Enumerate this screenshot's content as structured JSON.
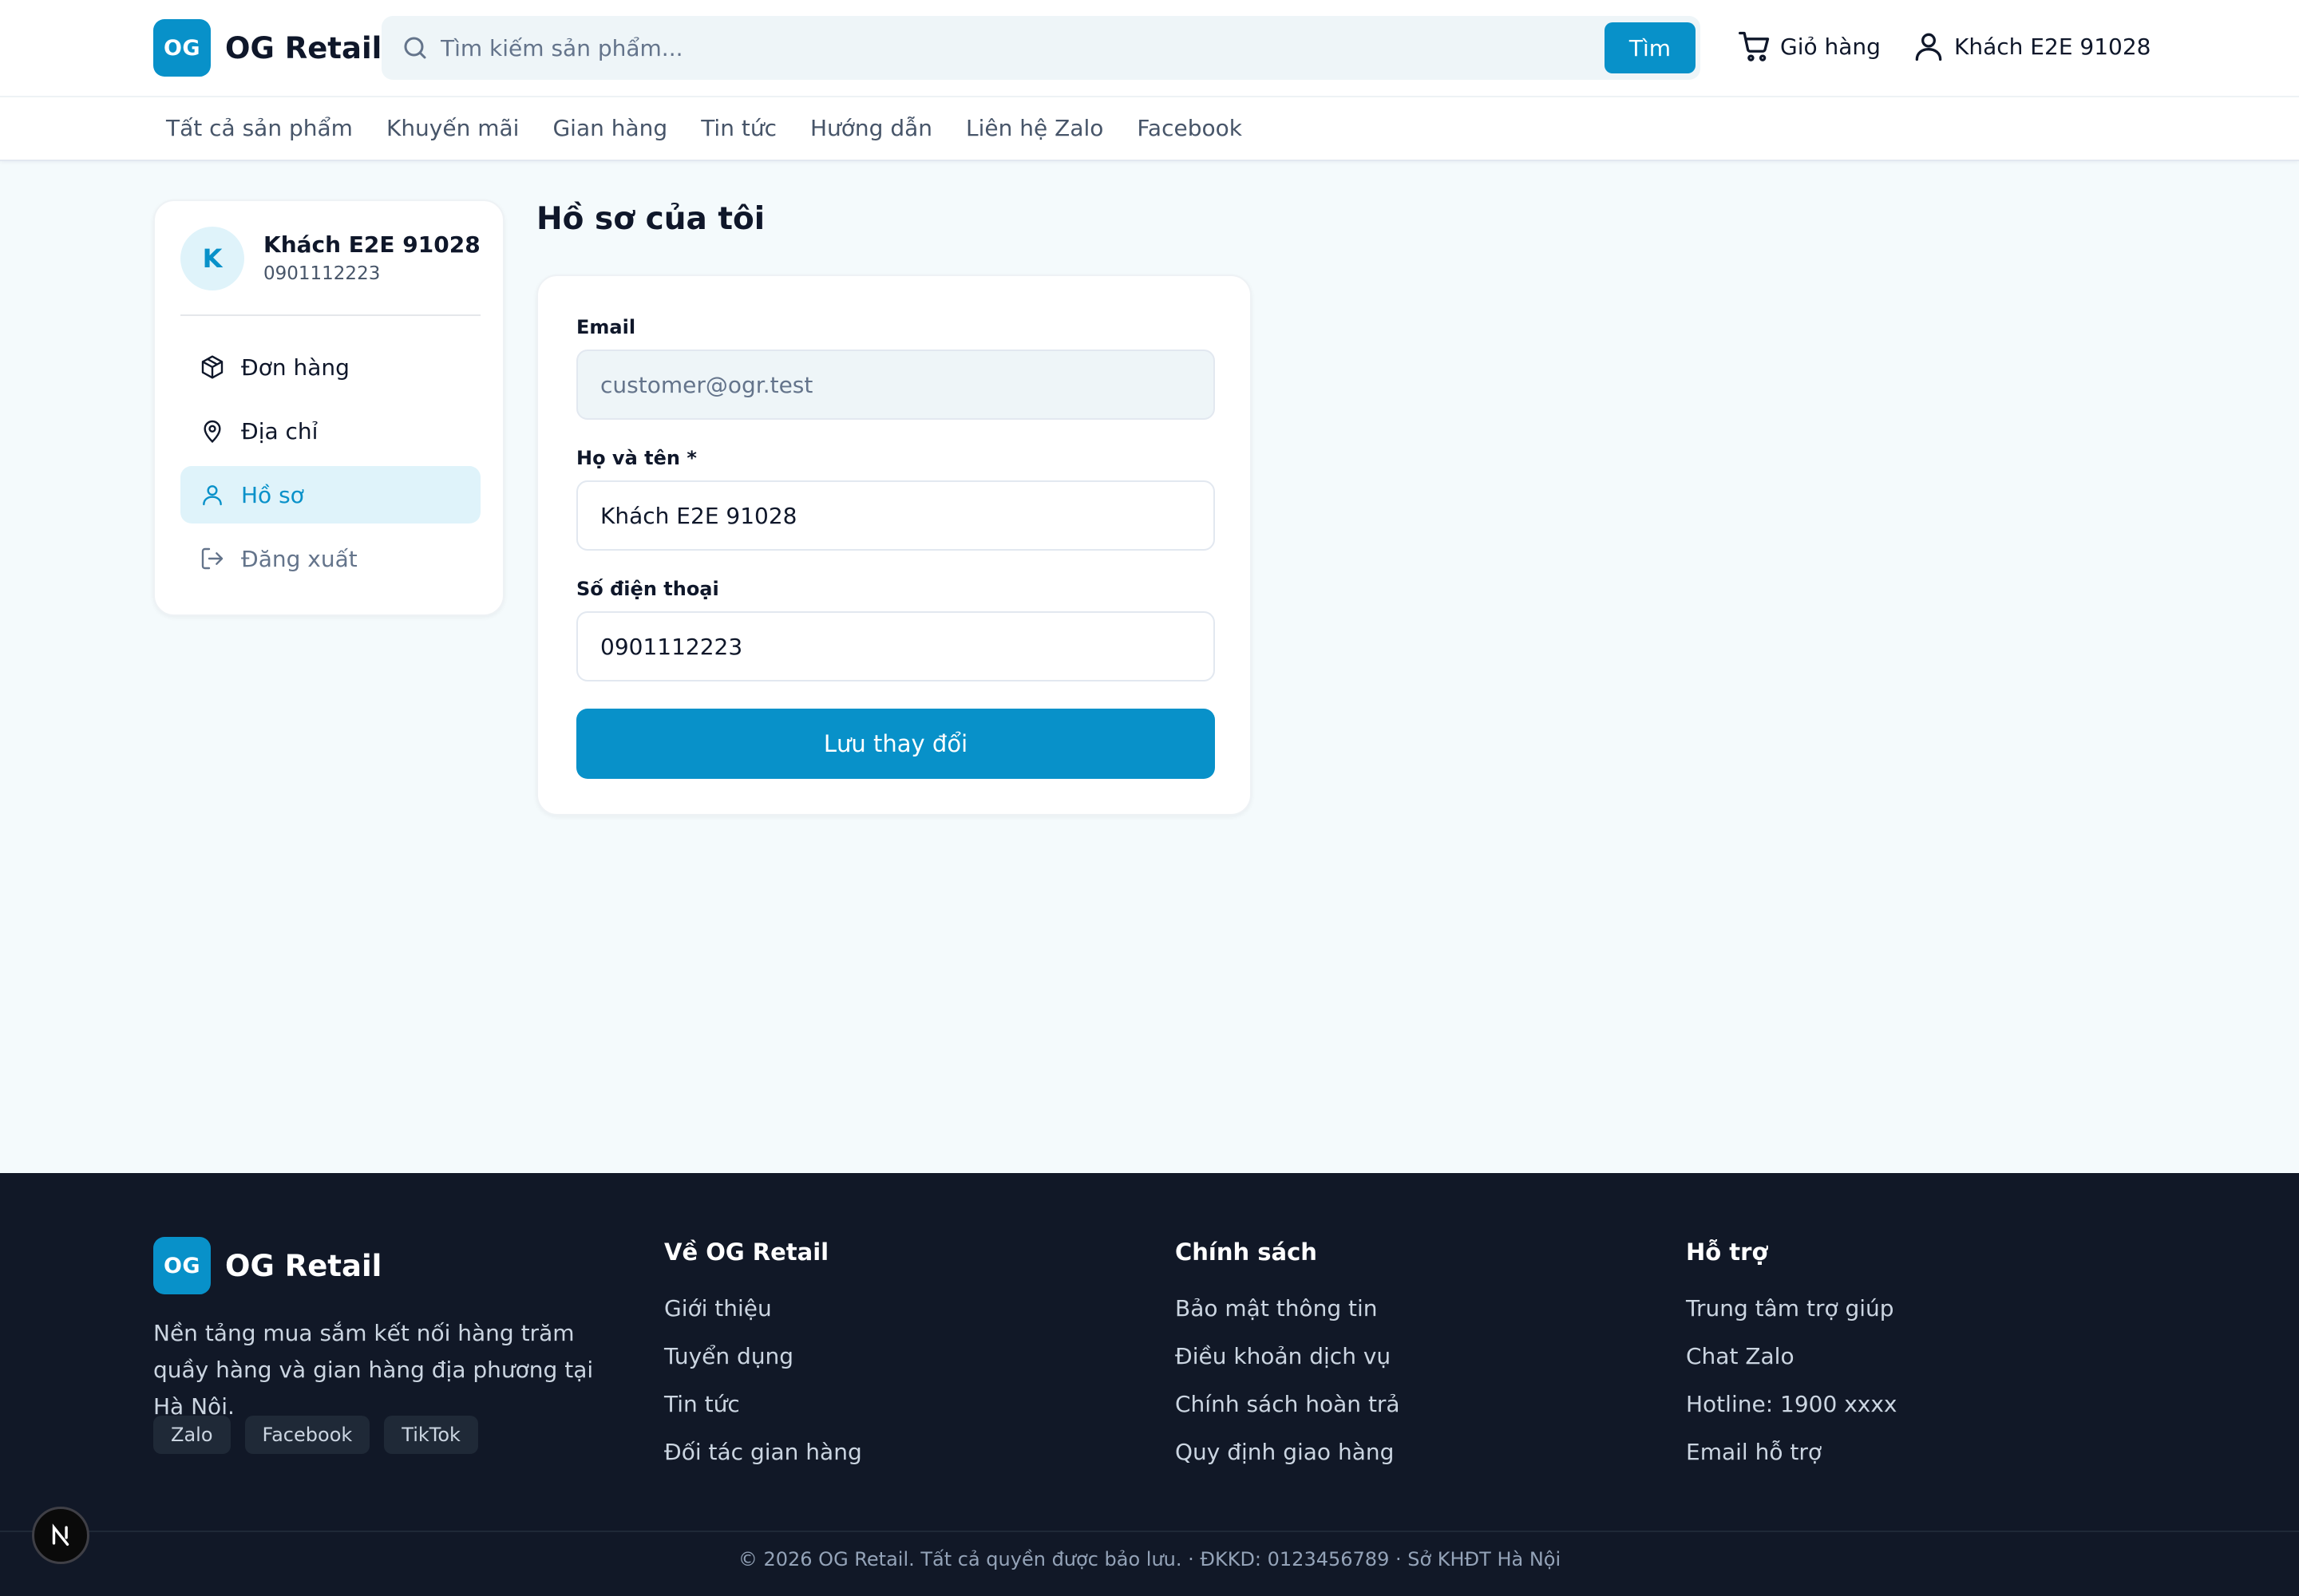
{
  "brand": {
    "badge": "OG",
    "name": "OG Retail",
    "accent": "#0891c9"
  },
  "header": {
    "search_placeholder": "Tìm kiếm sản phẩm...",
    "search_button": "Tìm",
    "cart_label": "Giỏ hàng",
    "user_label": "Khách E2E 91028"
  },
  "nav": {
    "items": [
      "Tất cả sản phẩm",
      "Khuyến mãi",
      "Gian hàng",
      "Tin tức",
      "Hướng dẫn",
      "Liên hệ Zalo",
      "Facebook"
    ]
  },
  "sidebar": {
    "avatar_initial": "K",
    "name": "Khách E2E 91028",
    "phone": "0901112223",
    "items": [
      {
        "label": "Đơn hàng",
        "icon": "package-icon"
      },
      {
        "label": "Địa chỉ",
        "icon": "map-pin-icon"
      },
      {
        "label": "Hồ sơ",
        "icon": "user-icon",
        "active": true
      },
      {
        "label": "Đăng xuất",
        "icon": "logout-icon"
      }
    ]
  },
  "profile": {
    "title": "Hồ sơ của tôi",
    "email_label": "Email",
    "email_value": "customer@ogr.test",
    "name_label": "Họ và tên *",
    "name_value": "Khách E2E 91028",
    "phone_label": "Số điện thoại",
    "phone_value": "0901112223",
    "save_button": "Lưu thay đổi"
  },
  "footer": {
    "brand_name": "OG Retail",
    "description": "Nền tảng mua sắm kết nối hàng trăm quầy hàng và gian hàng địa phương tại Hà Nội.",
    "socials": [
      "Zalo",
      "Facebook",
      "TikTok"
    ],
    "columns": [
      {
        "title": "Về OG Retail",
        "links": [
          "Giới thiệu",
          "Tuyển dụng",
          "Tin tức",
          "Đối tác gian hàng"
        ]
      },
      {
        "title": "Chính sách",
        "links": [
          "Bảo mật thông tin",
          "Điều khoản dịch vụ",
          "Chính sách hoàn trả",
          "Quy định giao hàng"
        ]
      },
      {
        "title": "Hỗ trợ",
        "links": [
          "Trung tâm trợ giúp",
          "Chat Zalo",
          "Hotline: 1900 xxxx",
          "Email hỗ trợ"
        ]
      }
    ],
    "copyright": "© 2026 OG Retail. Tất cả quyền được bảo lưu. · ĐKKD: 0123456789 · Sở KHĐT Hà Nội"
  }
}
